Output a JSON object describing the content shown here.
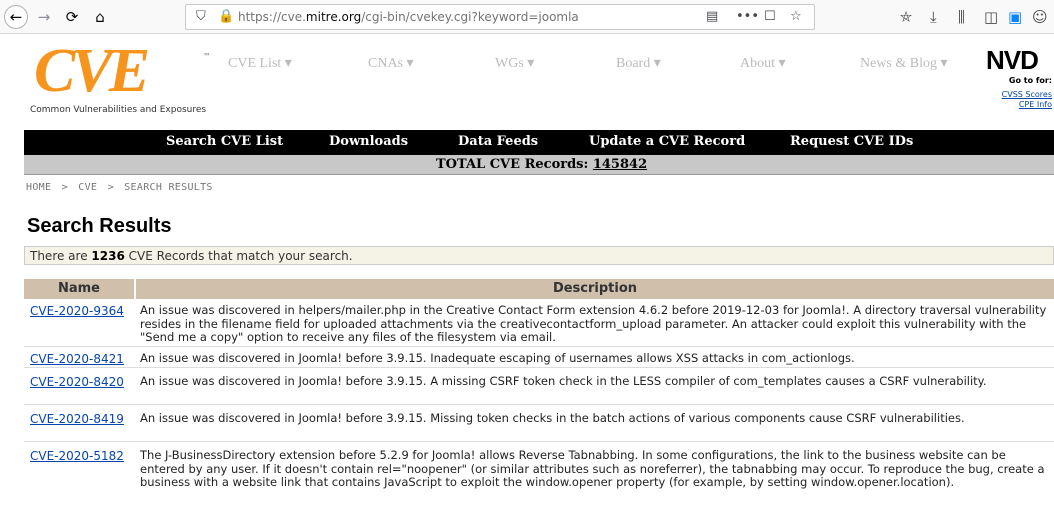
{
  "browser": {
    "url_prefix": "https://cve.",
    "url_domain": "mitre.org",
    "url_path": "/cgi-bin/cvekey.cgi?keyword=joomla"
  },
  "header": {
    "logo": "CVE",
    "logo_tm": "™",
    "logo_sub": "Common Vulnerabilities and Exposures",
    "menu": [
      "CVE List ▾",
      "CNAs ▾",
      "WGs ▾",
      "Board ▾",
      "About ▾",
      "News & Blog ▾"
    ],
    "nvd_logo": "NVD",
    "nvd_goto": "Go to for:",
    "nvd_links": [
      "CVSS Scores",
      "CPE Info"
    ]
  },
  "nav": {
    "items": [
      "Search CVE List",
      "Downloads",
      "Data Feeds",
      "Update a CVE Record",
      "Request CVE IDs"
    ]
  },
  "total": {
    "label": "TOTAL CVE Records:",
    "value": "145842"
  },
  "breadcrumb": [
    "HOME",
    ">",
    "CVE",
    ">",
    "SEARCH RESULTS"
  ],
  "page_title": "Search Results",
  "count": {
    "prefix": "There are",
    "value": "1236",
    "suffix": "CVE Records that match your search."
  },
  "table": {
    "headers": [
      "Name",
      "Description"
    ],
    "rows": [
      {
        "id": "CVE-2020-9364",
        "desc": "An issue was discovered in helpers/mailer.php in the Creative Contact Form extension 4.6.2 before 2019-12-03 for Joomla!. A directory traversal vulnerability resides in the filename field for uploaded attachments via the creativecontactform_upload parameter. An attacker could exploit this vulnerability with the \"Send me a copy\" option to receive any files of the filesystem via email."
      },
      {
        "id": "CVE-2020-8421",
        "desc": "An issue was discovered in Joomla! before 3.9.15. Inadequate escaping of usernames allows XSS attacks in com_actionlogs."
      },
      {
        "id": "CVE-2020-8420",
        "desc": "An issue was discovered in Joomla! before 3.9.15. A missing CSRF token check in the LESS compiler of com_templates causes a CSRF vulnerability."
      },
      {
        "id": "CVE-2020-8419",
        "desc": "An issue was discovered in Joomla! before 3.9.15. Missing token checks in the batch actions of various components cause CSRF vulnerabilities."
      },
      {
        "id": "CVE-2020-5182",
        "desc": "The J-BusinessDirectory extension before 5.2.9 for Joomla! allows Reverse Tabnabbing. In some configurations, the link to the business website can be entered by any user. If it doesn't contain rel=\"noopener\" (or similar attributes such as noreferrer), the tabnabbing may occur. To reproduce the bug, create a business with a website link that contains JavaScript to exploit the window.opener property (for example, by setting window.opener.location)."
      }
    ]
  }
}
